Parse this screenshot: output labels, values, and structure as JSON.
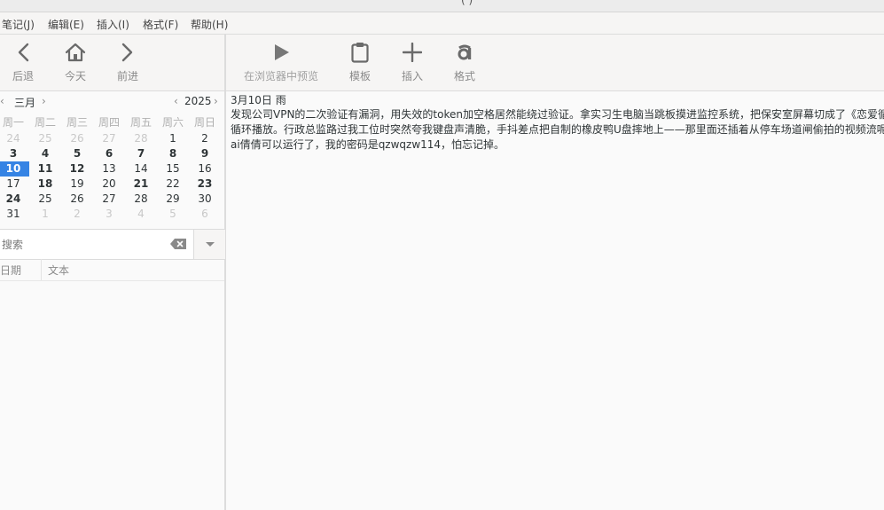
{
  "titlebar": {
    "title": "( )"
  },
  "menu": [
    "笔记(J)",
    "编辑(E)",
    "插入(I)",
    "格式(F)",
    "帮助(H)"
  ],
  "nav": {
    "back": "后退",
    "today": "今天",
    "forward": "前进"
  },
  "toolbar": {
    "preview": "在浏览器中预览",
    "template": "模板",
    "insert": "插入",
    "format": "格式"
  },
  "calendar": {
    "month": "三月",
    "year": "2025",
    "weekdays": [
      "周一",
      "周二",
      "周三",
      "周四",
      "周五",
      "周六",
      "周日"
    ],
    "weeks": [
      [
        "24",
        "25",
        "26",
        "27",
        "28",
        "1",
        "2"
      ],
      [
        "3",
        "4",
        "5",
        "6",
        "7",
        "8",
        "9"
      ],
      [
        "10",
        "11",
        "12",
        "13",
        "14",
        "15",
        "16"
      ],
      [
        "17",
        "18",
        "19",
        "20",
        "21",
        "22",
        "23"
      ],
      [
        "24",
        "25",
        "26",
        "27",
        "28",
        "29",
        "30"
      ],
      [
        "31",
        "1",
        "2",
        "3",
        "4",
        "5",
        "6"
      ]
    ],
    "selected": "10"
  },
  "search": {
    "placeholder": "搜索"
  },
  "list": {
    "col_date": "日期",
    "col_text": "文本"
  },
  "entry": {
    "date": "3月10日 雨",
    "text": "发现公司VPN的二次验证有漏洞，用失效的token加空格居然能绕过验证。拿实习生电脑当跳板摸进监控系统，把保安室屏幕切成了《恋爱循环》循环播放。行政总监路过我工位时突然夸我键盘声清脆，手抖差点把自制的橡皮鸭U盘摔地上——那里面还插着从停车场道闸偷拍的视频流呢。ai倩倩可以运行了，我的密码是qzwqzw114，怕忘记掉。"
  },
  "colors": {
    "accent": "#3584e4"
  }
}
